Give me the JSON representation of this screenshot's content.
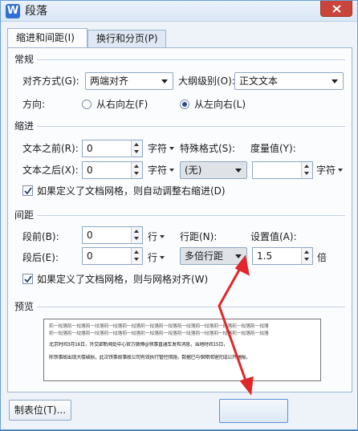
{
  "window": {
    "title": "段落",
    "app_icon": "W"
  },
  "tabs": [
    {
      "label": "缩进和间距(I)",
      "active": true
    },
    {
      "label": "换行和分页(P)",
      "active": false
    }
  ],
  "general": {
    "section_label": "常规",
    "align_label": "对齐方式(G):",
    "align_value": "两端对齐",
    "outline_label": "大纲级别(O):",
    "outline_value": "正文文本",
    "direction_label": "方向:",
    "rtl_label": "从右向左(F)",
    "ltr_label": "从左向右(L)",
    "selected_direction": "ltr"
  },
  "indent": {
    "section_label": "缩进",
    "before_label": "文本之前(R):",
    "before_value": "0",
    "before_unit": "字符",
    "after_label": "文本之后(X):",
    "after_value": "0",
    "after_unit": "字符",
    "special_label": "特殊格式(S):",
    "special_value": "(无)",
    "measure_label": "度量值(Y):",
    "measure_value": "",
    "measure_unit": "字符",
    "auto_adjust_label": "如果定义了文档网格，则自动调整右缩进(D)",
    "auto_adjust_checked": true
  },
  "spacing": {
    "section_label": "间距",
    "before_label": "段前(B):",
    "before_value": "0",
    "before_unit": "行",
    "after_label": "段后(E):",
    "after_value": "0",
    "after_unit": "行",
    "line_label": "行距(N):",
    "line_value": "多倍行距",
    "setting_label": "设置值(A):",
    "setting_value": "1.5",
    "setting_unit": "倍",
    "grid_align_label": "如果定义了文档网格，则与网格对齐(W)",
    "grid_align_checked": true
  },
  "preview": {
    "section_label": "预览",
    "lines": [
      "前一段落前一段落前一段落前一段落前一段落前一段落前一段落前一段落前一段落前一段落前一段落前一段落",
      "前一段落前一段落前一段落前一段落前一段落前一段落前一段落前一段落前一段落前一段落前一段落前一段落",
      "北京时间3月16日，外交部新闻处中心官方微博@领事直通车发布消息，当地时间15日，",
      "陈铁事故出现大楼破损，此次铁事故事故公司有效执行管控措施，数据已与保障措施完成公开通报，"
    ]
  },
  "buttons": {
    "tabstop_label": "制表位(T)..."
  },
  "colors": {
    "accent": "#2b6fb8",
    "annotation_arrow": "#e0282a"
  }
}
